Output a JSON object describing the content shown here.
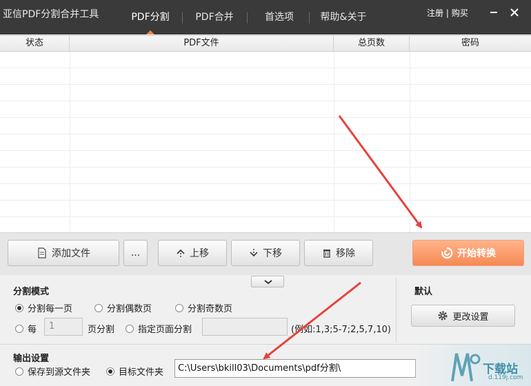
{
  "app": {
    "title": "亚信PDF分割合并工具"
  },
  "nav": {
    "tabs": [
      {
        "label": "PDF分割",
        "active": true
      },
      {
        "label": "PDF合并",
        "active": false
      },
      {
        "label": "首选项",
        "active": false
      },
      {
        "label": "帮助&关于",
        "active": false
      }
    ],
    "register_label": "注册",
    "separator": "|",
    "buy_label": "购买"
  },
  "table": {
    "columns": [
      "状态",
      "PDF文件",
      "总页数",
      "密码"
    ],
    "rows": []
  },
  "toolbar": {
    "add_file_label": "添加文件",
    "more_label": "...",
    "move_up_label": "上移",
    "move_down_label": "下移",
    "remove_label": "移除",
    "start_label": "开始转换"
  },
  "split_mode": {
    "title": "分割模式",
    "options": [
      {
        "label": "分割每一页",
        "checked": true
      },
      {
        "label": "分割偶数页",
        "checked": false
      },
      {
        "label": "分割奇数页",
        "checked": false
      }
    ],
    "every_label": "每",
    "every_value": "1",
    "every_suffix": "页分割",
    "specified_label": "指定页面分割",
    "specified_value": "",
    "example_text": "(例如:1,3;5-7;2,5,7,10)"
  },
  "defaults": {
    "title": "默认",
    "change_settings_label": "更改设置"
  },
  "output": {
    "title": "输出设置",
    "save_to_source_label": "保存到源文件夹",
    "save_to_source_checked": false,
    "target_folder_label": "目标文件夹",
    "target_folder_checked": true,
    "path": "C:\\Users\\bkill03\\Documents\\pdf分割\\"
  },
  "watermark": {
    "text": "下载站",
    "sub": "d.119j.com"
  },
  "colors": {
    "titlebar": "#3a3a3a",
    "accent": "#f0884a",
    "start_button": "#f58a55",
    "annotation_arrow": "#e8413d"
  }
}
